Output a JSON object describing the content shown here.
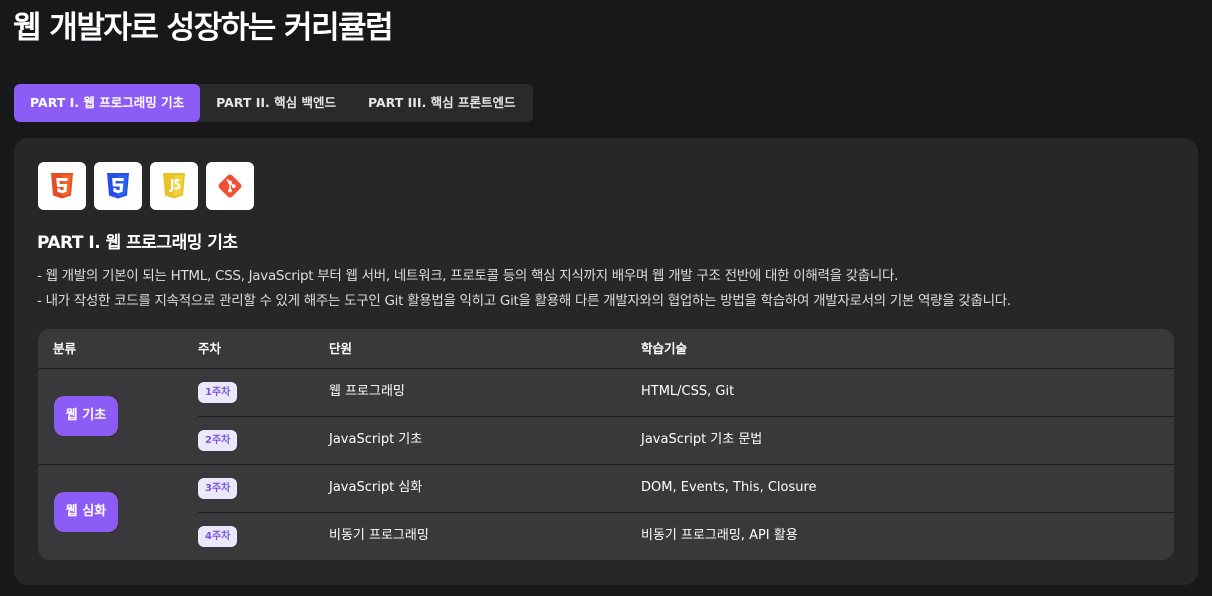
{
  "page": {
    "title": "웹 개발자로 성장하는 커리큘럼"
  },
  "tabs": [
    {
      "label": "PART I. 웹 프로그래밍 기초",
      "active": true
    },
    {
      "label": "PART II. 핵심 백엔드",
      "active": false
    },
    {
      "label": "PART III. 핵심 프론트엔드",
      "active": false
    }
  ],
  "panel": {
    "icons": [
      {
        "name": "html5-icon",
        "color": "#e44d26"
      },
      {
        "name": "css3-icon",
        "color": "#264de4"
      },
      {
        "name": "javascript-icon",
        "color": "#e8c229"
      },
      {
        "name": "git-icon",
        "color": "#f05033"
      }
    ],
    "title": "PART I. 웹 프로그래밍 기초",
    "descriptions": [
      "- 웹 개발의 기본이 되는 HTML, CSS, JavaScript 부터 웹 서버, 네트워크, 프로토콜 등의 핵심 지식까지 배우며 웹 개발 구조 전반에 대한 이해력을 갖춥니다.",
      "- 내가 작성한 코드를 지속적으로 관리할 수 있게 해주는 도구인 Git 활용법을 익히고 Git을 활용해 다른 개발자와의 협업하는 방법을 학습하여 개발자로서의 기본 역량을 갖춥니다."
    ],
    "table": {
      "headers": {
        "category": "분류",
        "week": "주차",
        "unit": "단원",
        "skills": "학습기술"
      },
      "groups": [
        {
          "category": "웹 기초",
          "rows": [
            {
              "week": "1주차",
              "unit": "웹 프로그래밍",
              "skills": "HTML/CSS, Git"
            },
            {
              "week": "2주차",
              "unit": "JavaScript 기초",
              "skills": "JavaScript 기초 문법"
            }
          ]
        },
        {
          "category": "웹 심화",
          "rows": [
            {
              "week": "3주차",
              "unit": "JavaScript 심화",
              "skills": "DOM, Events, This, Closure"
            },
            {
              "week": "4주차",
              "unit": "비동기 프로그래밍",
              "skills": "비동기 프로그래밍, API 활용"
            }
          ]
        }
      ]
    }
  }
}
